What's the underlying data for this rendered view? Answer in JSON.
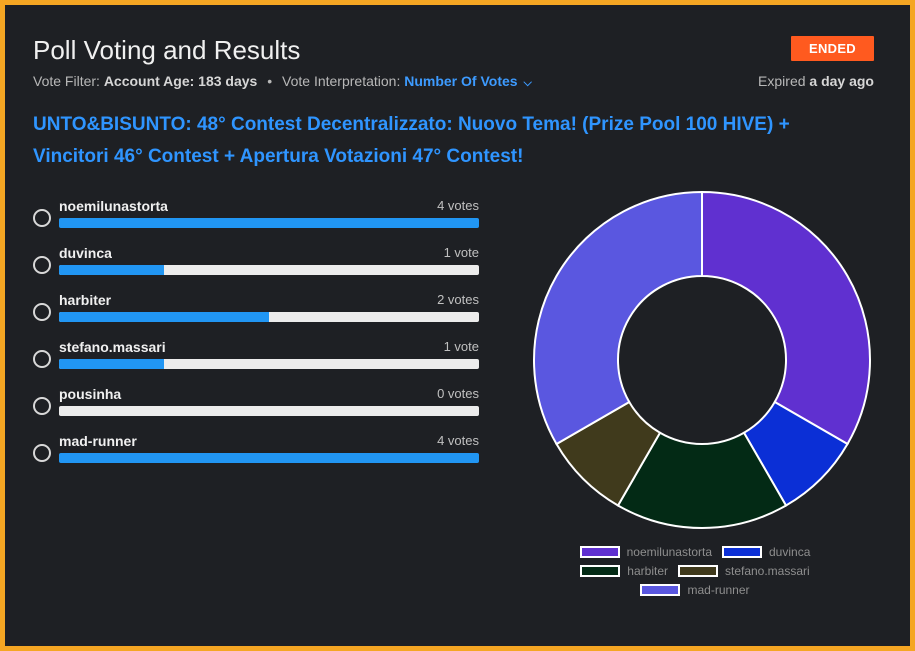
{
  "header": {
    "title": "Poll Voting and Results",
    "status_badge": "ENDED",
    "vote_filter_label": "Vote Filter:",
    "vote_filter_value": "Account Age: 183 days",
    "separator": "•",
    "interpretation_label": "Vote Interpretation:",
    "interpretation_value": "Number Of Votes",
    "expired_prefix": "Expired",
    "expired_value": "a day ago"
  },
  "question": "UNTO&BISUNTO: 48° Contest Decentralizzato: Nuovo Tema! (Prize Pool 100 HIVE) + Vincitori 46° Contest + Apertura Votazioni 47° Contest!",
  "options": [
    {
      "name": "noemilunastorta",
      "votes_label": "4 votes",
      "fraction": 1.0
    },
    {
      "name": "duvinca",
      "votes_label": "1 vote",
      "fraction": 0.25
    },
    {
      "name": "harbiter",
      "votes_label": "2 votes",
      "fraction": 0.5
    },
    {
      "name": "stefano.massari",
      "votes_label": "1 vote",
      "fraction": 0.25
    },
    {
      "name": "pousinha",
      "votes_label": "0 votes",
      "fraction": 0.0
    },
    {
      "name": "mad-runner",
      "votes_label": "4 votes",
      "fraction": 1.0
    }
  ],
  "colors": {
    "accent": "#2196f3",
    "badge": "#ff5a1f",
    "frame": "#f5a623"
  },
  "chart_data": {
    "type": "pie",
    "donut": true,
    "categories": [
      "noemilunastorta",
      "duvinca",
      "harbiter",
      "stefano.massari",
      "pousinha",
      "mad-runner"
    ],
    "values": [
      4,
      1,
      2,
      1,
      0,
      4
    ],
    "colors": [
      "#6030d0",
      "#0b2fd6",
      "#032a15",
      "#403a1c",
      "#cccccc",
      "#5a57e0"
    ],
    "legend": [
      "noemilunastorta",
      "duvinca",
      "harbiter",
      "stefano.massari",
      "mad-runner"
    ],
    "legend_colors": [
      "#6030d0",
      "#0b2fd6",
      "#032a15",
      "#403a1c",
      "#5a57e0"
    ],
    "legend_position": "bottom"
  }
}
